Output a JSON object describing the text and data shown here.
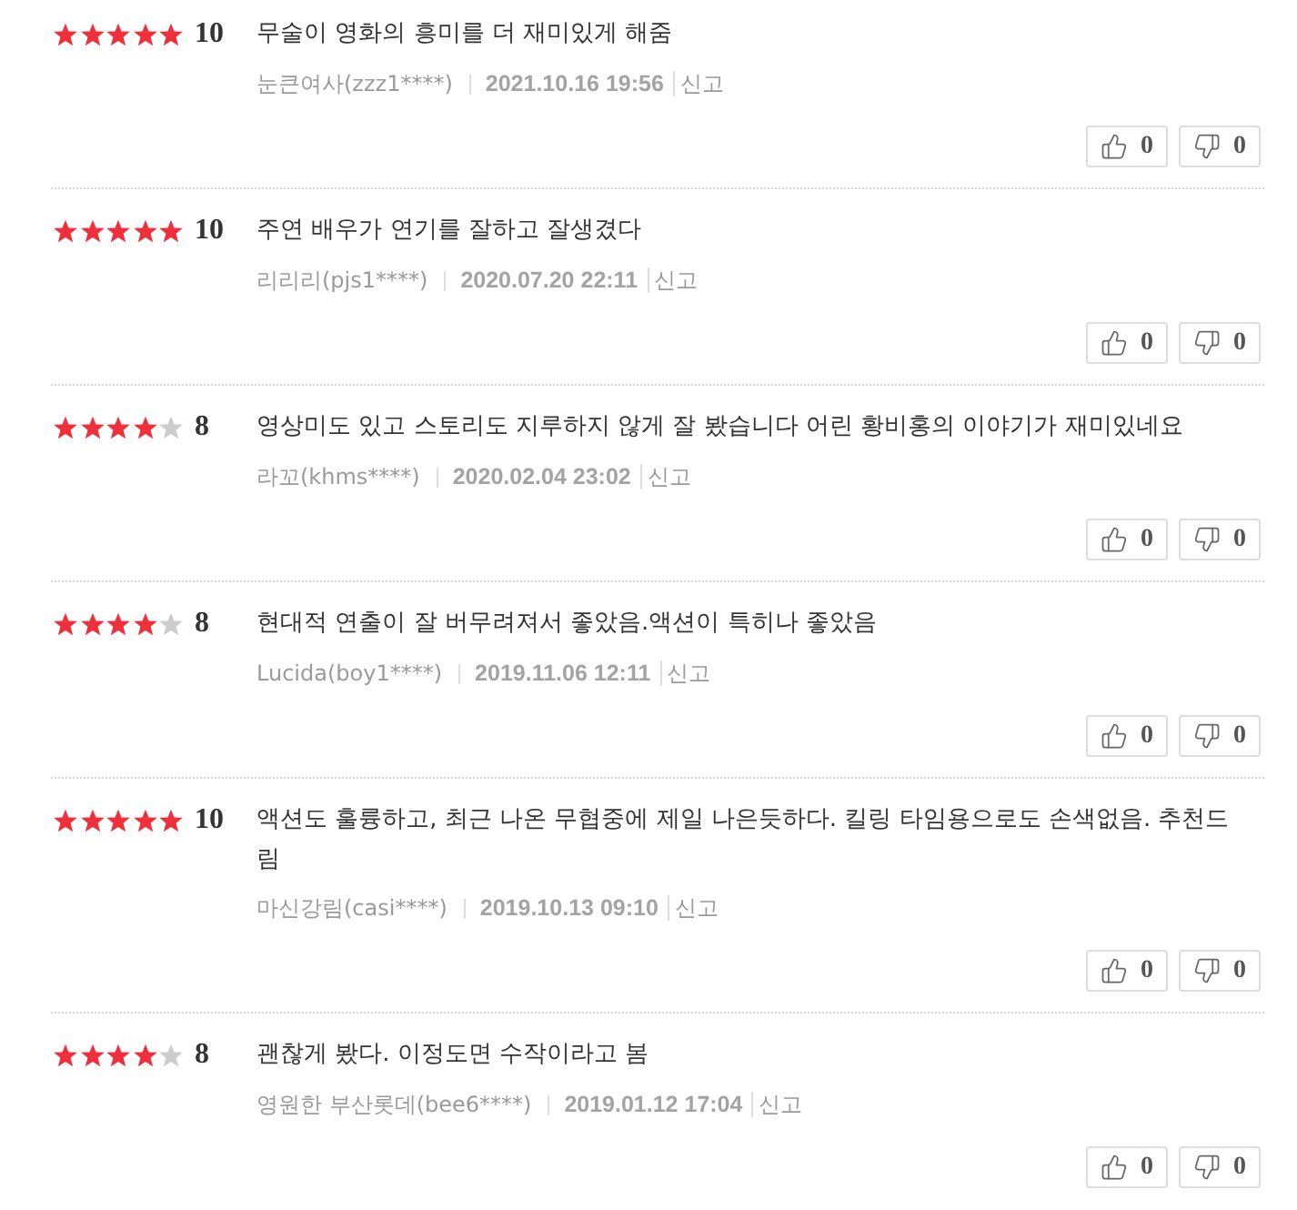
{
  "reviews": [
    {
      "stars": 5,
      "score": "10",
      "comment": "무술이 영화의 흥미를 더 재미있게 해줌",
      "author": "눈큰여사(zzz1****)",
      "date": "2021.10.16 19:56",
      "report": "신고",
      "likes": "0",
      "dislikes": "0"
    },
    {
      "stars": 5,
      "score": "10",
      "comment": "주연 배우가 연기를 잘하고 잘생겼다",
      "author": "리리리(pjs1****)",
      "date": "2020.07.20 22:11",
      "report": "신고",
      "likes": "0",
      "dislikes": "0"
    },
    {
      "stars": 4,
      "score": "8",
      "comment": "영상미도 있고 스토리도 지루하지 않게 잘 봤습니다 어린 황비홍의 이야기가 재미있네요",
      "author": "라꼬(khms****)",
      "date": "2020.02.04 23:02",
      "report": "신고",
      "likes": "0",
      "dislikes": "0"
    },
    {
      "stars": 4,
      "score": "8",
      "comment": "현대적 연출이 잘 버무려져서 좋았음.액션이 특히나 좋았음",
      "author": "Lucida(boy1****)",
      "date": "2019.11.06 12:11",
      "report": "신고",
      "likes": "0",
      "dislikes": "0"
    },
    {
      "stars": 5,
      "score": "10",
      "comment": "액션도 훌륭하고, 최근 나온 무협중에 제일 나은듯하다. 킬링 타임용으로도 손색없음. 추천드림",
      "author": "마신강림(casi****)",
      "date": "2019.10.13 09:10",
      "report": "신고",
      "likes": "0",
      "dislikes": "0"
    },
    {
      "stars": 4,
      "score": "8",
      "comment": "괜찮게 봤다. 이정도면 수작이라고 봄",
      "author": "영원한 부산롯데(bee6****)",
      "date": "2019.01.12 17:04",
      "report": "신고",
      "likes": "0",
      "dislikes": "0"
    }
  ]
}
